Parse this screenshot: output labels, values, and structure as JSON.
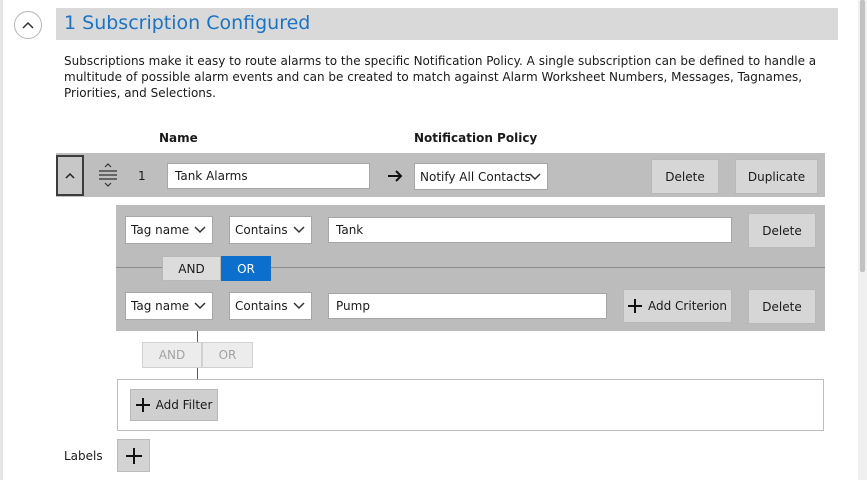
{
  "header": {
    "title": "1 Subscription Configured",
    "description": "Subscriptions make it easy to route alarms to the specific Notification Policy. A single subscription can be defined to handle a multitude of possible alarm events and can be created to match against Alarm Worksheet Numbers, Messages, Tagnames, Priorities, and Selections."
  },
  "columns": {
    "name": "Name",
    "notification_policy": "Notification Policy"
  },
  "subscription": {
    "index": "1",
    "name_value": "Tank Alarms",
    "policy_value": "Notify All Contacts",
    "delete_label": "Delete",
    "duplicate_label": "Duplicate"
  },
  "filter": {
    "criteria": [
      {
        "field": "Tag name",
        "operator": "Contains",
        "value": "Tank",
        "delete_label": "Delete"
      },
      {
        "field": "Tag name",
        "operator": "Contains",
        "value": "Pump",
        "delete_label": "Delete"
      }
    ],
    "and_label": "AND",
    "or_label": "OR",
    "active_logic": "OR",
    "add_criterion_label": "Add Criterion"
  },
  "filter_logic": {
    "and_label": "AND",
    "or_label": "OR"
  },
  "add_filter_label": "Add Filter",
  "labels": {
    "label": "Labels"
  },
  "colors": {
    "accent": "#0c6fce",
    "title": "#1a73c5"
  }
}
